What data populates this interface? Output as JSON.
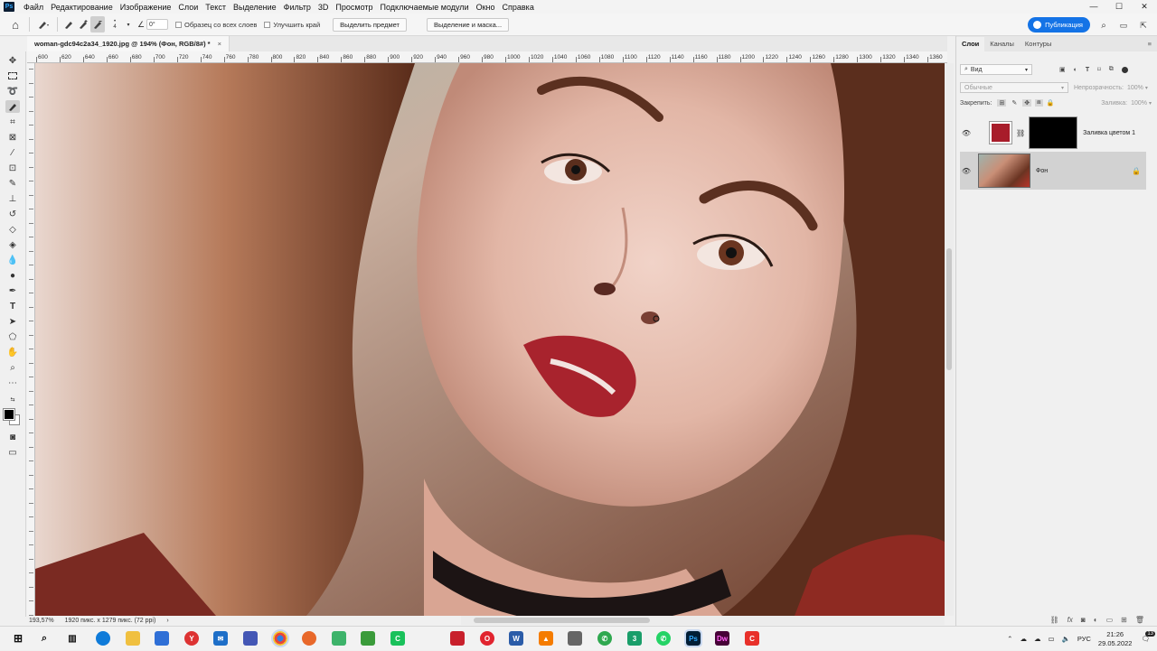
{
  "app": {
    "logo": "Ps",
    "window_controls": [
      "—",
      "☐",
      "✕"
    ]
  },
  "menu": [
    "Файл",
    "Редактирование",
    "Изображение",
    "Слои",
    "Текст",
    "Выделение",
    "Фильтр",
    "3D",
    "Просмотр",
    "Подключаемые модули",
    "Окно",
    "Справка"
  ],
  "options": {
    "brush_size": "4",
    "angle": "0°",
    "sample_all_layers": "Образец со всех слоев",
    "enhance_edge": "Улучшить край",
    "select_subject": "Выделить предмет",
    "select_and_mask": "Выделение и маска...",
    "publish": "Публикация"
  },
  "document": {
    "tab_title": "woman-gdc94c2a34_1920.jpg @ 194% (Фон, RGB/8#) *",
    "close": "×"
  },
  "ruler": {
    "ticks": [
      "600",
      "620",
      "640",
      "660",
      "680",
      "700",
      "720",
      "740",
      "760",
      "780",
      "800",
      "820",
      "840",
      "860",
      "880",
      "900",
      "920",
      "940",
      "960",
      "980",
      "1000",
      "1020",
      "1040",
      "1060",
      "1080",
      "1100",
      "1120",
      "1140",
      "1160",
      "1180",
      "1200",
      "1220",
      "1240",
      "1260",
      "1280",
      "1300",
      "1320",
      "1340",
      "1360"
    ]
  },
  "status": {
    "zoom": "193,57%",
    "doc_info": "1920 пикс. x 1279 пикс. (72 ppi)",
    "arrow": "›"
  },
  "panel": {
    "tabs": [
      "Слои",
      "Каналы",
      "Контуры"
    ],
    "filter_kind": "Вид",
    "blend_mode": "Обычные",
    "opacity_label": "Непрозрачность:",
    "opacity_value": "100%",
    "lock_label": "Закрепить:",
    "fill_label": "Заливка:",
    "fill_value": "100%",
    "layers": [
      {
        "name": "Заливка цветом 1",
        "swatch": "#a81c2a"
      },
      {
        "name": "Фон"
      }
    ]
  },
  "taskbar": {
    "lang": "РУС",
    "time": "21:26",
    "date": "29.05.2022",
    "notif": "13"
  },
  "colors": {
    "accent": "#1473e6",
    "fill_swatch": "#a81c2a",
    "foreground": "#000000",
    "background": "#ffffff"
  }
}
